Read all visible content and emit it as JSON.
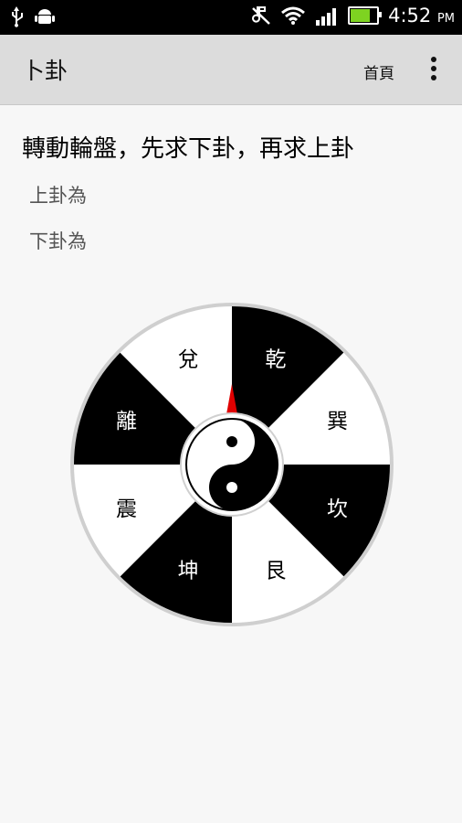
{
  "status_bar": {
    "time": "4:52",
    "ampm": "PM",
    "icons": [
      "usb-icon",
      "android-debug-icon",
      "mute-icon",
      "wifi-icon",
      "signal-icon",
      "battery-charging-icon"
    ],
    "battery_level": 0.7
  },
  "action_bar": {
    "title": "卜卦",
    "home_label": "首頁",
    "overflow_icon": "overflow-menu-icon"
  },
  "main": {
    "instruction": "轉動輪盤，先求下卦，再求上卦",
    "upper_label": "上卦為",
    "lower_label": "下卦為"
  },
  "wheel": {
    "segments": [
      {
        "label": "乾",
        "fill": "#000000"
      },
      {
        "label": "巽",
        "fill": "#ffffff"
      },
      {
        "label": "坎",
        "fill": "#000000"
      },
      {
        "label": "艮",
        "fill": "#ffffff"
      },
      {
        "label": "坤",
        "fill": "#000000"
      },
      {
        "label": "震",
        "fill": "#ffffff"
      },
      {
        "label": "離",
        "fill": "#000000"
      },
      {
        "label": "兌",
        "fill": "#ffffff"
      }
    ],
    "pointer_color": "#e00000",
    "rim_color": "#cfcfcf"
  }
}
